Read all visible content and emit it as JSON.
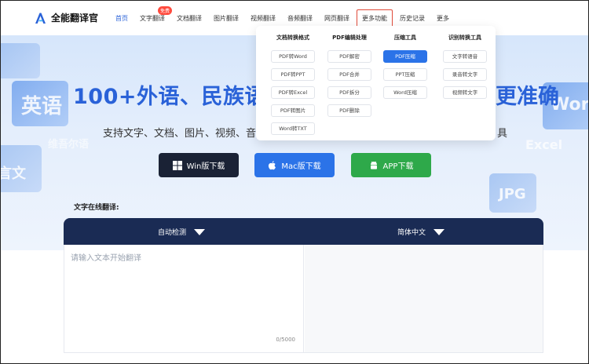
{
  "app": {
    "name": "全能翻译官"
  },
  "nav": [
    {
      "label": "首页",
      "active": true
    },
    {
      "label": "文字翻译",
      "badge": "免费"
    },
    {
      "label": "文档翻译"
    },
    {
      "label": "图片翻译"
    },
    {
      "label": "视频翻译"
    },
    {
      "label": "音频翻译"
    },
    {
      "label": "网页翻译"
    },
    {
      "label": "更多功能",
      "highlighted": true
    },
    {
      "label": "历史记录"
    },
    {
      "label": "更多"
    }
  ],
  "dropdown": {
    "columns": [
      {
        "title": "文档转换格式",
        "items": [
          "PDF转Word",
          "PDF转PPT",
          "PDF转Excel",
          "PDF转图片",
          "Word转TXT"
        ]
      },
      {
        "title": "PDF编辑处理",
        "items": [
          "PDF解密",
          "PDF合并",
          "PDF拆分",
          "PDF删除"
        ]
      },
      {
        "title": "压缩工具",
        "items": [
          "PDF压缩",
          "PPT压缩",
          "Word压缩"
        ],
        "selected": "PDF压缩"
      },
      {
        "title": "识别转换工具",
        "items": [
          "文字转语音",
          "录音转文字",
          "视频转文字"
        ]
      }
    ]
  },
  "hero": {
    "title": "100+外语、民族语",
    "title_tail": "更准确",
    "subtitle": "支持文字、文档、图片、视频、音频",
    "subtitle_tail": "具",
    "deco_words": [
      "英语",
      "Word",
      "Excel",
      "JPG",
      "言文",
      "维吾尔语"
    ]
  },
  "downloads": {
    "win": "Win版下载",
    "mac": "Mac版下载",
    "app": "APP下载"
  },
  "translator": {
    "section_label": "文字在线翻译:",
    "source_lang": "自动检测",
    "target_lang": "简体中文",
    "placeholder": "请输入文本开始翻译",
    "counter": "0/5000"
  },
  "colors": {
    "accent": "#2a62d8",
    "win_btn": "#1a2235",
    "mac_btn": "#2b73e8",
    "app_btn": "#2ea94a",
    "bar": "#1a2b54",
    "highlight_border": "#e04b3a"
  }
}
